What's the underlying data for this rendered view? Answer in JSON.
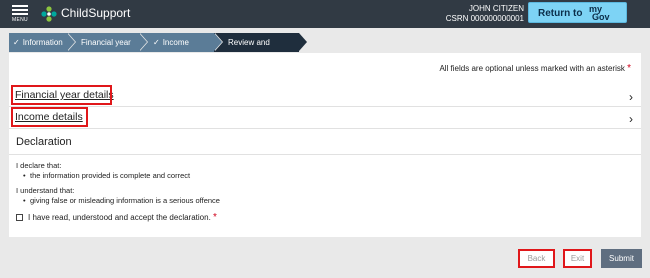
{
  "header": {
    "menu_label": "MENU",
    "brand": "ChildSupport",
    "user_name": "JOHN CITIZEN",
    "csrn": "CSRN 000000000001",
    "return_label": "Return to",
    "mygov_my": "my",
    "mygov_gov": "Gov"
  },
  "steps": [
    {
      "label": "Information",
      "completed": true
    },
    {
      "label": "Financial year",
      "completed": false
    },
    {
      "label": "Income details",
      "completed": true
    },
    {
      "label": "Review and submit",
      "completed": false,
      "active": true
    }
  ],
  "form": {
    "optional_note": "All fields are optional unless marked with an asterisk",
    "required_marker": "*",
    "sections": [
      {
        "label": "Financial year details"
      },
      {
        "label": "Income details"
      }
    ],
    "declaration_title": "Declaration",
    "declare_intro": "I declare that:",
    "declare_items": [
      "the information provided is complete and correct"
    ],
    "understand_intro": "I understand that:",
    "understand_items": [
      "giving false or misleading information is a serious offence"
    ],
    "checkbox_label": "I have read, understood and accept the declaration.",
    "checkbox_checked": false
  },
  "footer": {
    "back_label": "Back",
    "exit_label": "Exit",
    "submit_label": "Submit"
  },
  "colors": {
    "header_bg": "#313a44",
    "step_bg": "#5b7c97",
    "step_active_bg": "#1f2e3d",
    "highlight": "#e0171a",
    "submit_bg": "#5f6e80",
    "mygov_bg": "#7dd3f5"
  }
}
